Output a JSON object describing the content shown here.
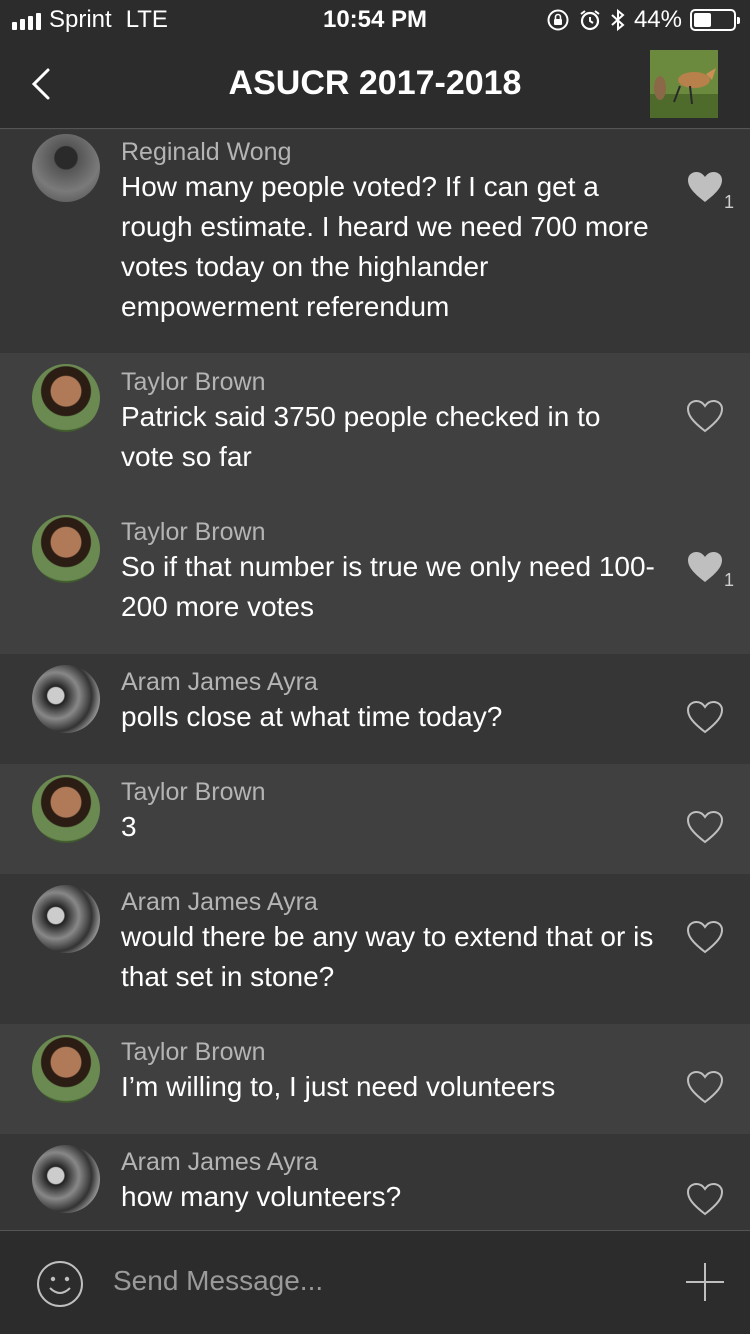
{
  "status_bar": {
    "carrier": "Sprint",
    "network": "LTE",
    "time": "10:54 PM",
    "battery": "44%",
    "battery_level": 0.44
  },
  "nav": {
    "title": "ASUCR 2017-2018"
  },
  "messages": [
    {
      "name": "Reginald Wong",
      "text": "How many people voted? If I can get a rough estimate. I heard we need 700 more votes today on the highlander empowerment referendum",
      "liked": true,
      "likes": "1"
    },
    {
      "name": "Taylor Brown",
      "text": "Patrick said 3750 people checked in to vote so far",
      "liked": false,
      "likes": ""
    },
    {
      "name": "Taylor Brown",
      "text": "So if that number is true we only need 100-200 more votes",
      "liked": true,
      "likes": "1"
    },
    {
      "name": "Aram James Ayra",
      "text": "polls close at what time today?",
      "liked": false,
      "likes": ""
    },
    {
      "name": "Taylor Brown",
      "text": "3",
      "liked": false,
      "likes": ""
    },
    {
      "name": "Aram James Ayra",
      "text": "would there be any way to extend that or is that set in stone?",
      "liked": false,
      "likes": ""
    },
    {
      "name": "Taylor Brown",
      "text": "I’m willing to, I just need volunteers",
      "liked": false,
      "likes": ""
    },
    {
      "name": "Aram James Ayra",
      "text": "how many volunteers?",
      "liked": false,
      "likes": ""
    }
  ],
  "input": {
    "placeholder": "Send Message..."
  },
  "colors": {
    "bar_bg": "#2c2c2c",
    "row_dark": "#363636",
    "row_light": "#404040",
    "name_text": "#b4b4b4",
    "placeholder_text": "#9a9a9a"
  }
}
